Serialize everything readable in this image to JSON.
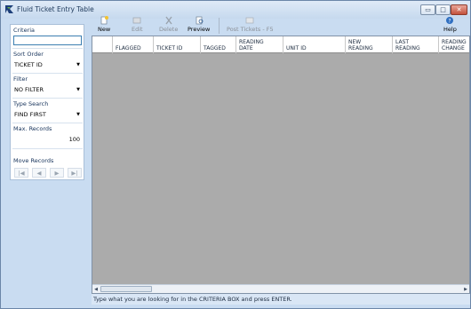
{
  "window": {
    "title": "Fluid Ticket Entry Table",
    "minimize_glyph": "▭",
    "maximize_glyph": "□",
    "close_glyph": "✕"
  },
  "toolbar": {
    "new_label": "New",
    "edit_label": "Edit",
    "delete_label": "Delete",
    "preview_label": "Preview",
    "post_label": "Post Tickets - F5",
    "help_label": "Help"
  },
  "sidebar": {
    "criteria_label": "Criteria",
    "criteria_value": "",
    "sort_order_label": "Sort Order",
    "sort_order_value": "TICKET ID",
    "filter_label": "Filter",
    "filter_value": "NO FILTER",
    "type_search_label": "Type Search",
    "type_search_value": "FIND FIRST",
    "max_records_label": "Max. Records",
    "max_records_value": "100",
    "move_records_label": "Move Records"
  },
  "grid": {
    "columns": [
      "FLAGGED",
      "TICKET ID",
      "TAGGED",
      "READING\nDATE",
      "UNIT ID",
      "NEW\nREADING",
      "LAST\nREADING",
      "READING\nCHANGE"
    ]
  },
  "status": {
    "text": "Type what you are looking for in the CRITERIA BOX and press ENTER."
  },
  "icons": {
    "app": "fluid-logo-icon",
    "new": "new-document-icon",
    "edit": "edit-icon",
    "delete": "delete-icon",
    "preview": "preview-icon",
    "post": "post-icon",
    "help": "help-icon"
  },
  "colors": {
    "window_frame": "#c9dcf1",
    "grid_background": "#ababab",
    "status_bar": "#d9e6f5"
  }
}
